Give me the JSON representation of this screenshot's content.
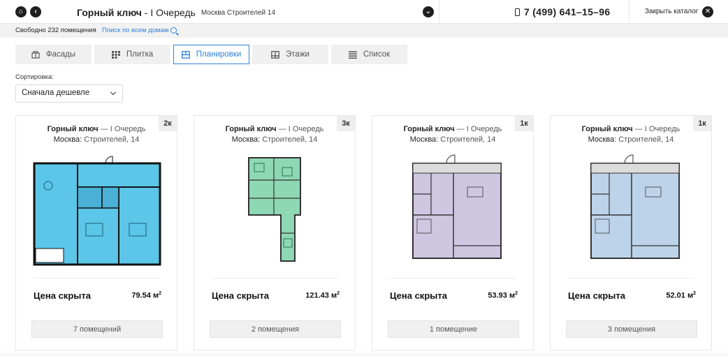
{
  "header": {
    "title_bold": "Горный ключ",
    "title_rest": " - I Очередь",
    "address": "Москва Строителей 14",
    "phone": "7 (499) 641–15–96",
    "close_label": "Закрыть каталог"
  },
  "subbar": {
    "free_text": "Свободно 232 помещения",
    "search_text": "Поиск по всем домам"
  },
  "tabs": [
    {
      "label": "Фасады",
      "icon": "facade-icon"
    },
    {
      "label": "Плитка",
      "icon": "tiles-icon"
    },
    {
      "label": "Планировки",
      "icon": "plan-icon",
      "active": true
    },
    {
      "label": "Этажи",
      "icon": "floors-icon"
    },
    {
      "label": "Список",
      "icon": "list-icon"
    }
  ],
  "sort": {
    "label": "Сортировка:",
    "value": "Сначала дешевле"
  },
  "cards": [
    {
      "badge": "2к",
      "complex": "Горный ключ",
      "queue": " — I Очередь",
      "city": "Москва:",
      "street": " Строителей, 14",
      "price": "Цена скрыта",
      "area": "79.54 м",
      "area_unit_sup": "2",
      "rooms": "7 помещений",
      "plan_color": "#5bc6e8"
    },
    {
      "badge": "3к",
      "complex": "Горный ключ",
      "queue": " — I Очередь",
      "city": "Москва:",
      "street": " Строителей, 14",
      "price": "Цена скрыта",
      "area": "121.43 м",
      "area_unit_sup": "2",
      "rooms": "2 помещения",
      "plan_color": "#8fd8b4"
    },
    {
      "badge": "1к",
      "complex": "Горный ключ",
      "queue": " — I Очередь",
      "city": "Москва:",
      "street": " Строителей, 14",
      "price": "Цена скрыта",
      "area": "53.93 м",
      "area_unit_sup": "2",
      "rooms": "1 помещение",
      "plan_color": "#cfc6e2"
    },
    {
      "badge": "1к",
      "complex": "Горный ключ",
      "queue": " — I Очередь",
      "city": "Москва:",
      "street": " Строителей, 14",
      "price": "Цена скрыта",
      "area": "52.01 м",
      "area_unit_sup": "2",
      "rooms": "3 помещения",
      "plan_color": "#bcd3ea"
    }
  ]
}
